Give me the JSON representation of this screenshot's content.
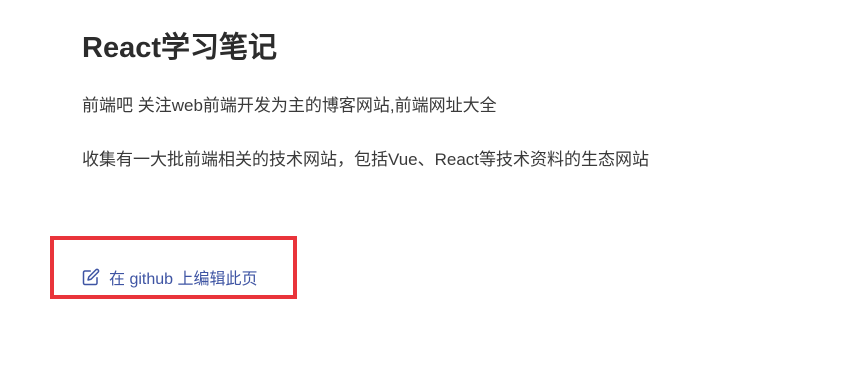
{
  "article": {
    "title": "React学习笔记",
    "paragraphs": [
      "前端吧 关注web前端开发为主的博客网站,前端网址大全",
      "收集有一大批前端相关的技术网站，包括Vue、React等技术资料的生态网站"
    ]
  },
  "edit_link": {
    "icon": "edit-icon",
    "label": "在 github 上编辑此页"
  },
  "colors": {
    "link": "#3e54a3",
    "highlight_border": "#e9343a"
  }
}
